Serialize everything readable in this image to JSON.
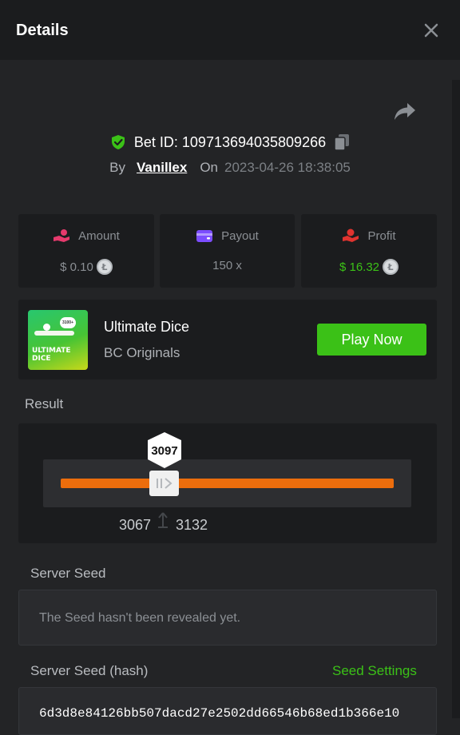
{
  "header": {
    "title": "Details",
    "close_icon": "close-icon"
  },
  "bet": {
    "id_label": "Bet ID: 109713694035809266",
    "by_label": "By",
    "user": "Vanillex",
    "on_label": "On",
    "datetime": "2023-04-26 18:38:05"
  },
  "stats": {
    "amount": {
      "label": "Amount",
      "value": "$ 0.10",
      "icon": "coins-hand-icon",
      "color": "#e63a6d"
    },
    "payout": {
      "label": "Payout",
      "value": "150 x",
      "icon": "wallet-icon",
      "color": "#7c4dff"
    },
    "profit": {
      "label": "Profit",
      "value": "$ 16.32",
      "icon": "hand-money-icon",
      "color": "#e0332f",
      "value_color": "#3bc117"
    },
    "coin_symbol": "Ł"
  },
  "game": {
    "thumb_title": "ULTIMATE DICE",
    "thumb_badge": "3100+",
    "name": "Ultimate Dice",
    "provider": "BC Originals",
    "play_label": "Play Now"
  },
  "result": {
    "label": "Result",
    "roll": "3097",
    "range_low": "3067",
    "range_high": "3132"
  },
  "server_seed": {
    "label": "Server Seed",
    "value": "The Seed hasn't been revealed yet."
  },
  "server_seed_hash": {
    "label": "Server Seed (hash)",
    "settings_label": "Seed Settings",
    "value": "6d3d8e84126bb507dacd27e2502dd66546b68ed1b366e10"
  },
  "colors": {
    "accent_green": "#3bc117",
    "track_orange": "#ec6d0c",
    "bg": "#232426",
    "card": "#1b1c1e"
  }
}
